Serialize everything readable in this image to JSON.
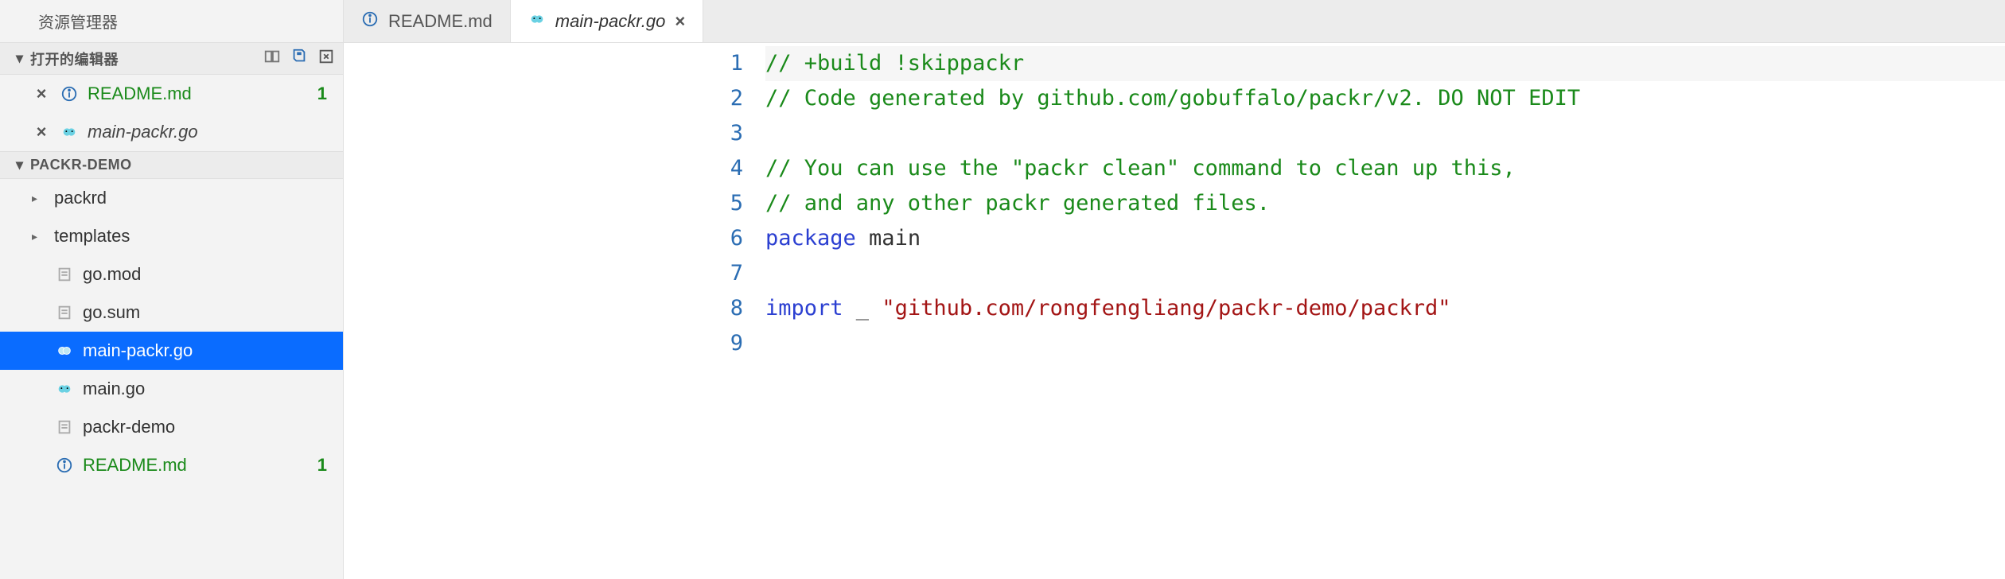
{
  "sidebar": {
    "title": "资源管理器",
    "open_editors": {
      "label": "打开的编辑器",
      "items": [
        {
          "name": "README.md",
          "badge": "1",
          "classes": "readme"
        },
        {
          "name": "main-packr.go",
          "badge": "",
          "classes": "main-packr-open"
        }
      ]
    },
    "workspace": {
      "label": "PACKR-DEMO",
      "items": [
        {
          "name": "packrd",
          "kind": "folder"
        },
        {
          "name": "templates",
          "kind": "folder"
        },
        {
          "name": "go.mod",
          "kind": "file-text"
        },
        {
          "name": "go.sum",
          "kind": "file-text"
        },
        {
          "name": "main-packr.go",
          "kind": "file-go",
          "selected": true
        },
        {
          "name": "main.go",
          "kind": "file-go"
        },
        {
          "name": "packr-demo",
          "kind": "file-text"
        },
        {
          "name": "README.md",
          "kind": "file-info",
          "badge": "1",
          "classes": "readme"
        }
      ]
    }
  },
  "tabs": [
    {
      "name": "README.md",
      "icon": "info",
      "active": false
    },
    {
      "name": "main-packr.go",
      "icon": "go",
      "active": true,
      "closable": true
    }
  ],
  "editor": {
    "filename": "main-packr.go",
    "current_line": 1,
    "lines": [
      {
        "n": 1,
        "tokens": [
          {
            "cls": "tok-comment",
            "t": "// +build !skippackr"
          }
        ]
      },
      {
        "n": 2,
        "tokens": [
          {
            "cls": "tok-comment",
            "t": "// Code generated by github.com/gobuffalo/packr/v2. DO NOT EDIT"
          }
        ]
      },
      {
        "n": 3,
        "tokens": []
      },
      {
        "n": 4,
        "tokens": [
          {
            "cls": "tok-comment",
            "t": "// You can use the \"packr clean\" command to clean up this,"
          }
        ]
      },
      {
        "n": 5,
        "tokens": [
          {
            "cls": "tok-comment",
            "t": "// and any other packr generated files."
          }
        ]
      },
      {
        "n": 6,
        "tokens": [
          {
            "cls": "tok-keyword",
            "t": "package"
          },
          {
            "cls": "tok-ident",
            "t": " main"
          }
        ]
      },
      {
        "n": 7,
        "tokens": []
      },
      {
        "n": 8,
        "tokens": [
          {
            "cls": "tok-keyword",
            "t": "import"
          },
          {
            "cls": "tok-ident",
            "t": " _ "
          },
          {
            "cls": "tok-string",
            "t": "\"github.com/rongfengliang/packr-demo/packrd\""
          }
        ]
      },
      {
        "n": 9,
        "tokens": []
      }
    ]
  }
}
